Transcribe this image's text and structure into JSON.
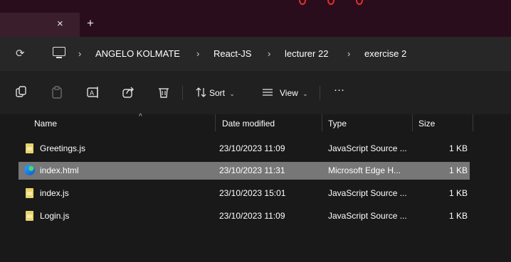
{
  "titlebar": {
    "tab_close_icon": "×",
    "new_tab_icon": "+"
  },
  "address": {
    "refresh_icon": "refresh-icon",
    "breadcrumb": [
      "ANGELO KOLMATE",
      "React-JS",
      "lecturer 22",
      "exercise 2"
    ],
    "separator": "›"
  },
  "toolbar": {
    "sort_label": "Sort",
    "view_label": "View",
    "more_label": "···"
  },
  "columns": {
    "name": "Name",
    "date": "Date modified",
    "type": "Type",
    "size": "Size"
  },
  "files": [
    {
      "name": "Greetings.js",
      "date": "23/10/2023 11:09",
      "type": "JavaScript Source ...",
      "size": "1 KB",
      "icon": "js-file-icon",
      "selected": false
    },
    {
      "name": "index.html",
      "date": "23/10/2023 11:31",
      "type": "Microsoft Edge H...",
      "size": "1 KB",
      "icon": "edge-html-icon",
      "selected": true
    },
    {
      "name": "index.js",
      "date": "23/10/2023 15:01",
      "type": "JavaScript Source ...",
      "size": "1 KB",
      "icon": "js-file-icon",
      "selected": false
    },
    {
      "name": "Login.js",
      "date": "23/10/2023 11:09",
      "type": "JavaScript Source ...",
      "size": "1 KB",
      "icon": "js-file-icon",
      "selected": false
    }
  ],
  "colors": {
    "titlebar": "#2a0d1c",
    "selection": "#777777",
    "background": "#191919"
  }
}
